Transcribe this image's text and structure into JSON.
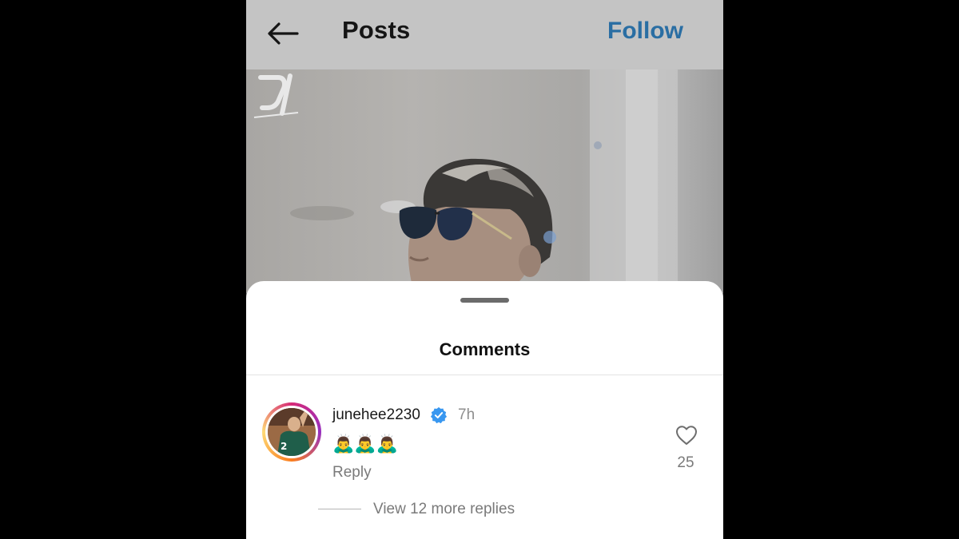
{
  "header": {
    "back_icon": "arrow-left-icon",
    "title": "Posts",
    "follow_label": "Follow",
    "follow_color": "#2a6ea3"
  },
  "photo": {
    "watermark_icon": "watermark-logo"
  },
  "comments_sheet": {
    "title": "Comments",
    "comment": {
      "username": "junehee2230",
      "verified_icon": "verified-badge-icon",
      "time": "7h",
      "text": "🙇‍♂️🙇‍♂️🙇‍♂️",
      "reply_label": "Reply",
      "like_icon": "heart-icon",
      "like_count": "25",
      "view_replies_label": "View 12 more replies"
    },
    "verified_color": "#3897f0",
    "avatar_ring_colors": [
      "#d62976",
      "#962fbf",
      "#fa7e1e",
      "#feda75"
    ]
  }
}
